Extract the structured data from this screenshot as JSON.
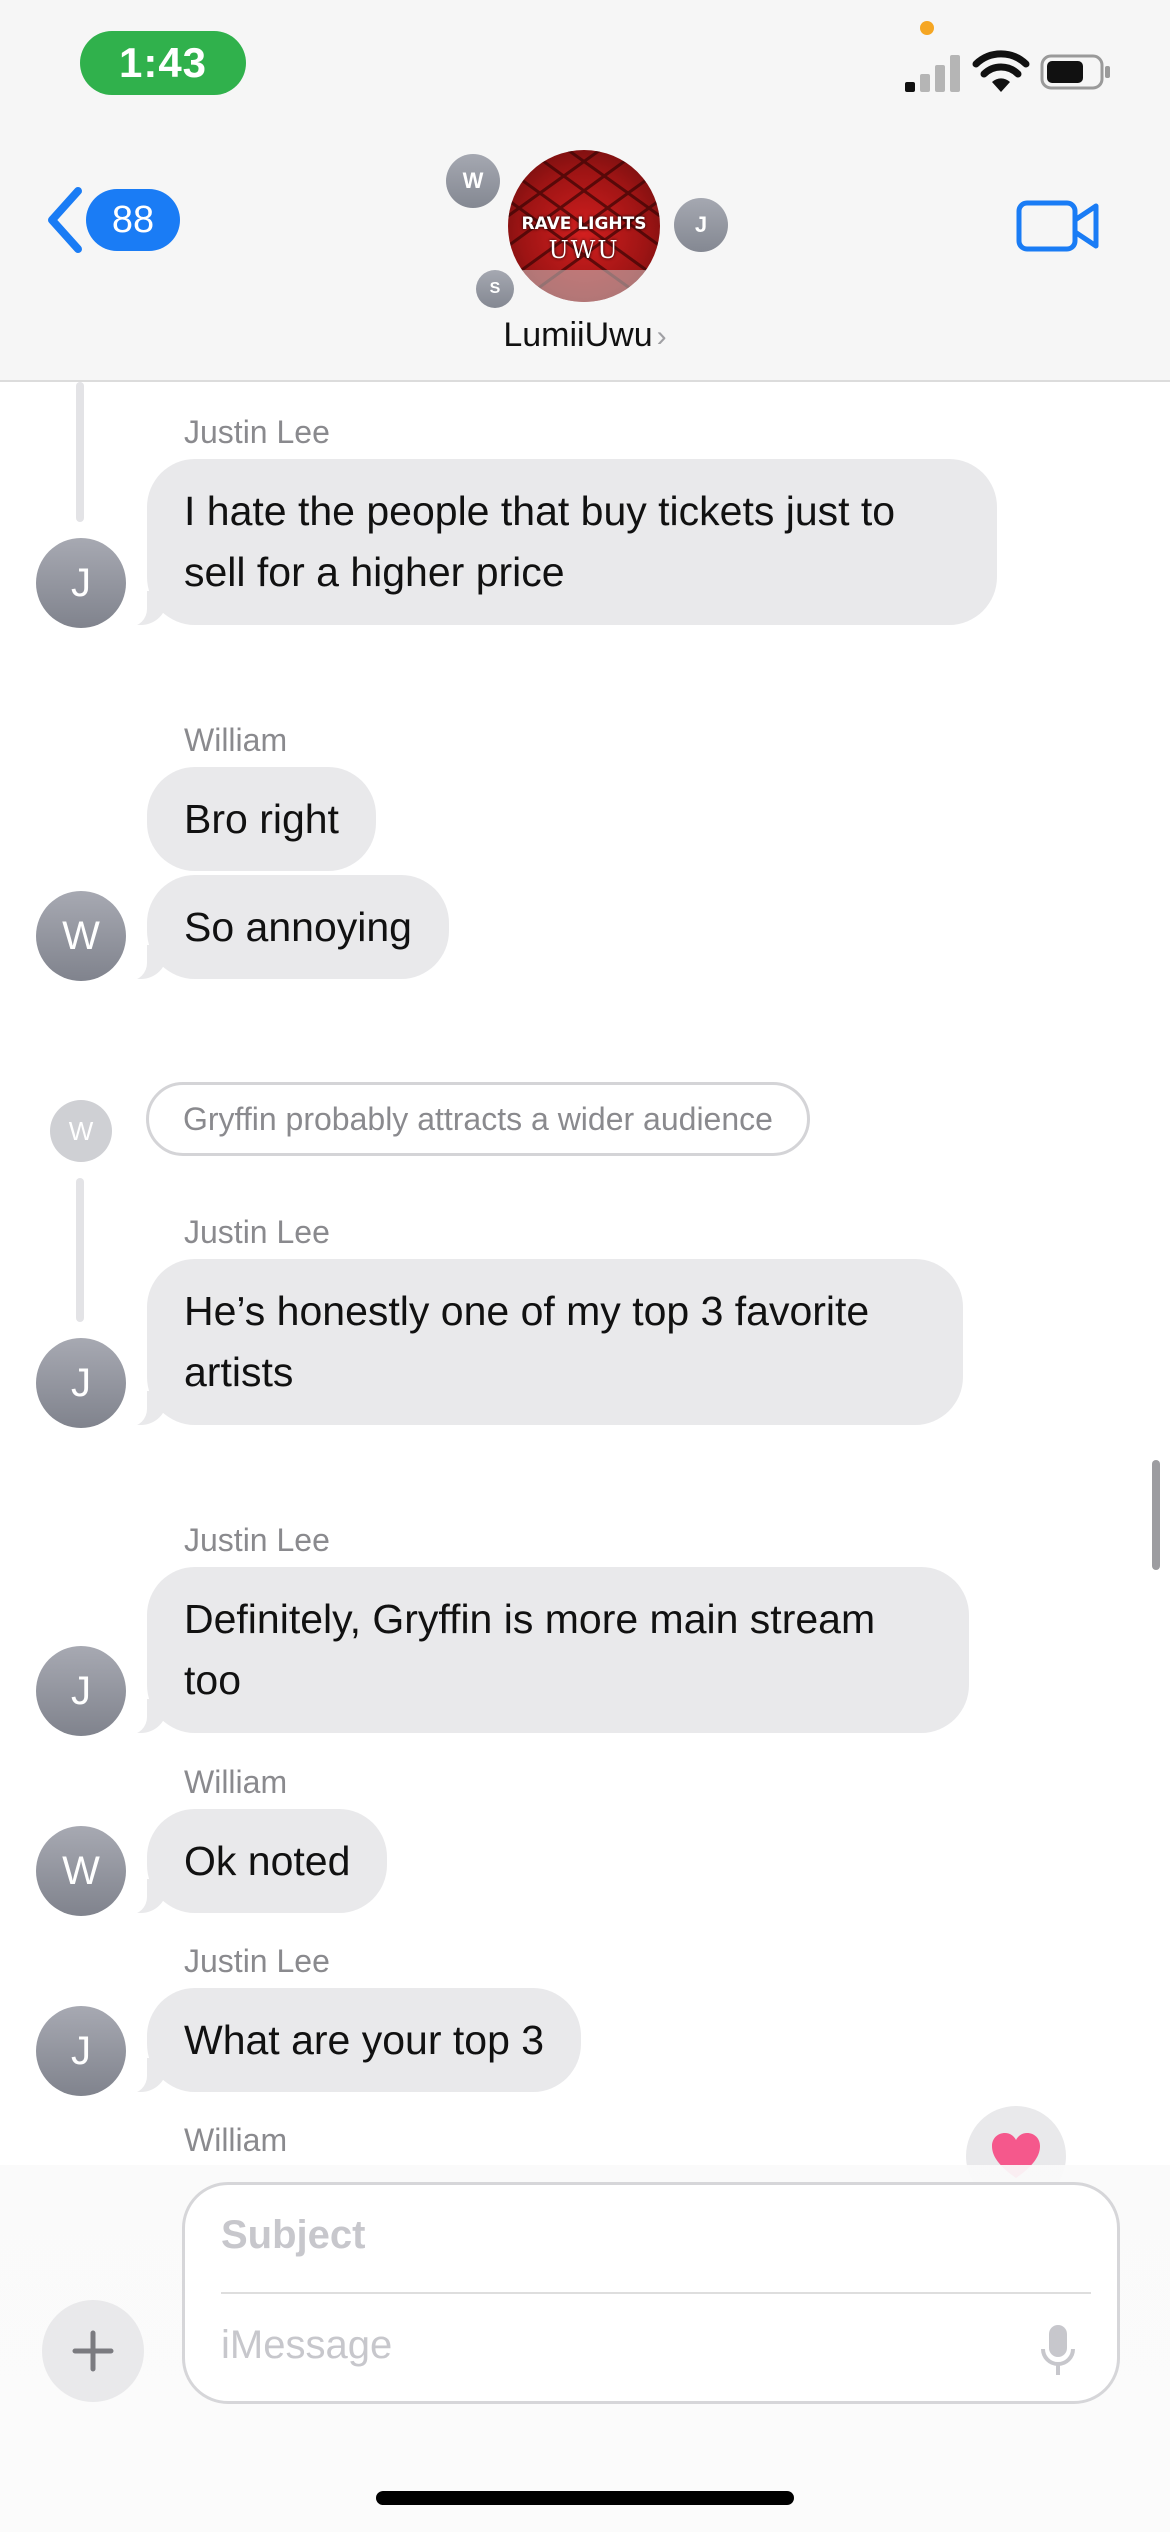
{
  "status_bar": {
    "time": "1:43",
    "signal_bars_active": 1,
    "signal_bars_total": 4,
    "battery_level": 0.7,
    "colors": {
      "time_pill": "#30b14c",
      "orange_dot": "#f5a623"
    }
  },
  "header": {
    "back_count": "88",
    "group_name": "LumiiUwu",
    "group_photo_text_1": "RAVE LIGHTS",
    "group_photo_text_2": "UWU",
    "member_initials": [
      "W",
      "J",
      "S"
    ],
    "colors": {
      "accent": "#1a7cf5"
    }
  },
  "messages": [
    {
      "sender": "Justin Lee",
      "initial": "J",
      "bubbles": [
        "I hate the people that buy tickets just to sell for a higher price"
      ]
    },
    {
      "sender": "William",
      "initial": "W",
      "bubbles": [
        "Bro right",
        "So annoying"
      ]
    },
    {
      "reply_to": {
        "initial": "W",
        "text": "Gryffin probably attracts a wider audience"
      }
    },
    {
      "sender": "Justin Lee",
      "initial": "J",
      "bubbles": [
        "He’s honestly one of my top 3 favorite artists"
      ]
    },
    {
      "sender": "Justin Lee",
      "initial": "J",
      "bubbles": [
        "Definitely, Gryffin is more main stream too"
      ]
    },
    {
      "sender": "William",
      "initial": "W",
      "bubbles": [
        "Ok noted"
      ]
    },
    {
      "sender": "Justin Lee",
      "initial": "J",
      "bubbles": [
        "What are your top 3"
      ]
    },
    {
      "sender": "William",
      "reaction_icon": "heart-icon"
    }
  ],
  "composer": {
    "subject_placeholder": "Subject",
    "message_placeholder": "iMessage",
    "icons": [
      "plus-icon",
      "microphone-icon"
    ]
  }
}
